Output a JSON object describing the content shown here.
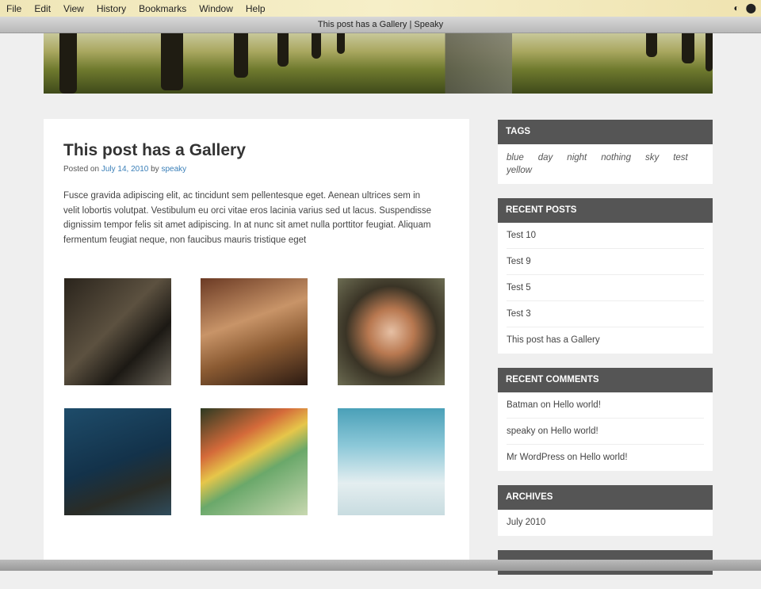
{
  "menubar": {
    "items": [
      "File",
      "Edit",
      "View",
      "History",
      "Bookmarks",
      "Window",
      "Help"
    ]
  },
  "window": {
    "title": "This post has a Gallery | Speaky"
  },
  "post": {
    "title": "This post has a Gallery",
    "posted_on": "Posted on",
    "date": "July 14, 2010",
    "by": "by",
    "author": "speaky",
    "body": "Fusce gravida adipiscing elit, ac tincidunt sem pellentesque eget. Aenean ultrices sem in velit lobortis volutpat. Vestibulum eu orci vitae eros lacinia varius sed ut lacus. Suspendisse dignissim tempor felis sit amet adipiscing. In at nunc sit amet nulla porttitor feugiat. Aliquam fermentum feugiat neque, non faucibus mauris tristique eget"
  },
  "sidebar": {
    "tags": {
      "title": "TAGS",
      "items": [
        "blue",
        "day",
        "night",
        "nothing",
        "sky",
        "test",
        "yellow"
      ]
    },
    "recent_posts": {
      "title": "RECENT POSTS",
      "items": [
        "Test 10",
        "Test 9",
        "Test 5",
        "Test 3",
        "This post has a Gallery"
      ]
    },
    "recent_comments": {
      "title": "RECENT COMMENTS",
      "items": [
        "Batman on Hello world!",
        "speaky on Hello world!",
        "Mr WordPress on Hello world!"
      ]
    },
    "archives": {
      "title": "ARCHIVES",
      "items": [
        "July 2010"
      ]
    }
  }
}
